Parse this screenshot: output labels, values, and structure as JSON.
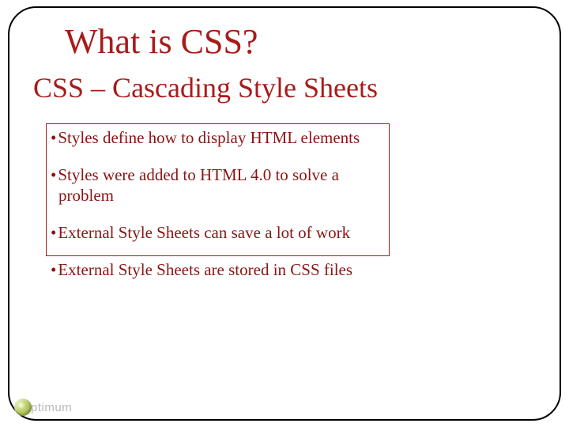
{
  "title": "What is CSS?",
  "subtitle": "CSS –  Cascading Style Sheets",
  "bullets": [
    "Styles define how to display HTML elements",
    "Styles were added to HTML 4.0 to solve a problem",
    "External Style Sheets can save a lot of work",
    "External Style Sheets are stored in CSS files"
  ],
  "watermark": "ptimum"
}
